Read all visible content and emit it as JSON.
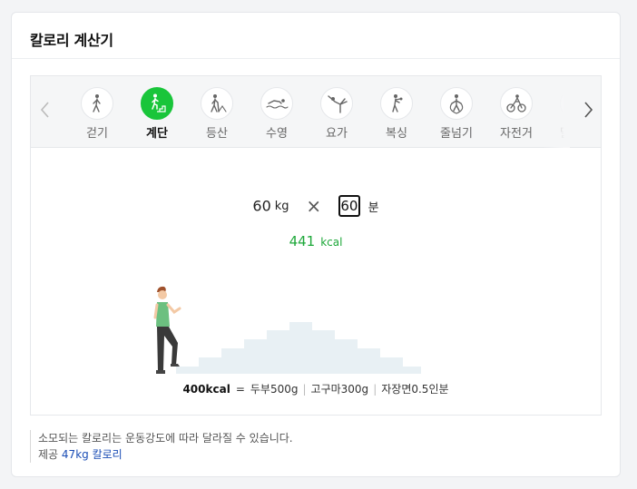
{
  "widget": {
    "title": "칼로리 계산기"
  },
  "activities": [
    {
      "label": "걷기",
      "icon": "walking-icon"
    },
    {
      "label": "계단",
      "icon": "stairs-icon",
      "active": true
    },
    {
      "label": "등산",
      "icon": "hiking-icon"
    },
    {
      "label": "수영",
      "icon": "swimming-icon"
    },
    {
      "label": "요가",
      "icon": "yoga-icon"
    },
    {
      "label": "복싱",
      "icon": "boxing-icon"
    },
    {
      "label": "줄넘기",
      "icon": "jump-rope-icon"
    },
    {
      "label": "자전거",
      "icon": "cycling-icon"
    },
    {
      "label": "달리기",
      "icon": "running-icon"
    }
  ],
  "calculator": {
    "weight_value": "60",
    "weight_unit": "kg",
    "minutes_value": "60",
    "minutes_unit": "분",
    "result_value": "441",
    "result_unit": "kcal"
  },
  "equivalence": {
    "kcal": "400kcal",
    "equals": "=",
    "items": [
      "두부500g",
      "고구마300g",
      "자장면0.5인분"
    ]
  },
  "note": {
    "line1": "소모되는 칼로리는 운동강도에 따라 달라질 수 있습니다.",
    "provider_prefix": "제공",
    "provider_link": "47kg 칼로리"
  },
  "colors": {
    "accent": "#19c53a",
    "result": "#1ea83a",
    "link": "#1a4db5",
    "stairs": "#e8f0f4"
  }
}
